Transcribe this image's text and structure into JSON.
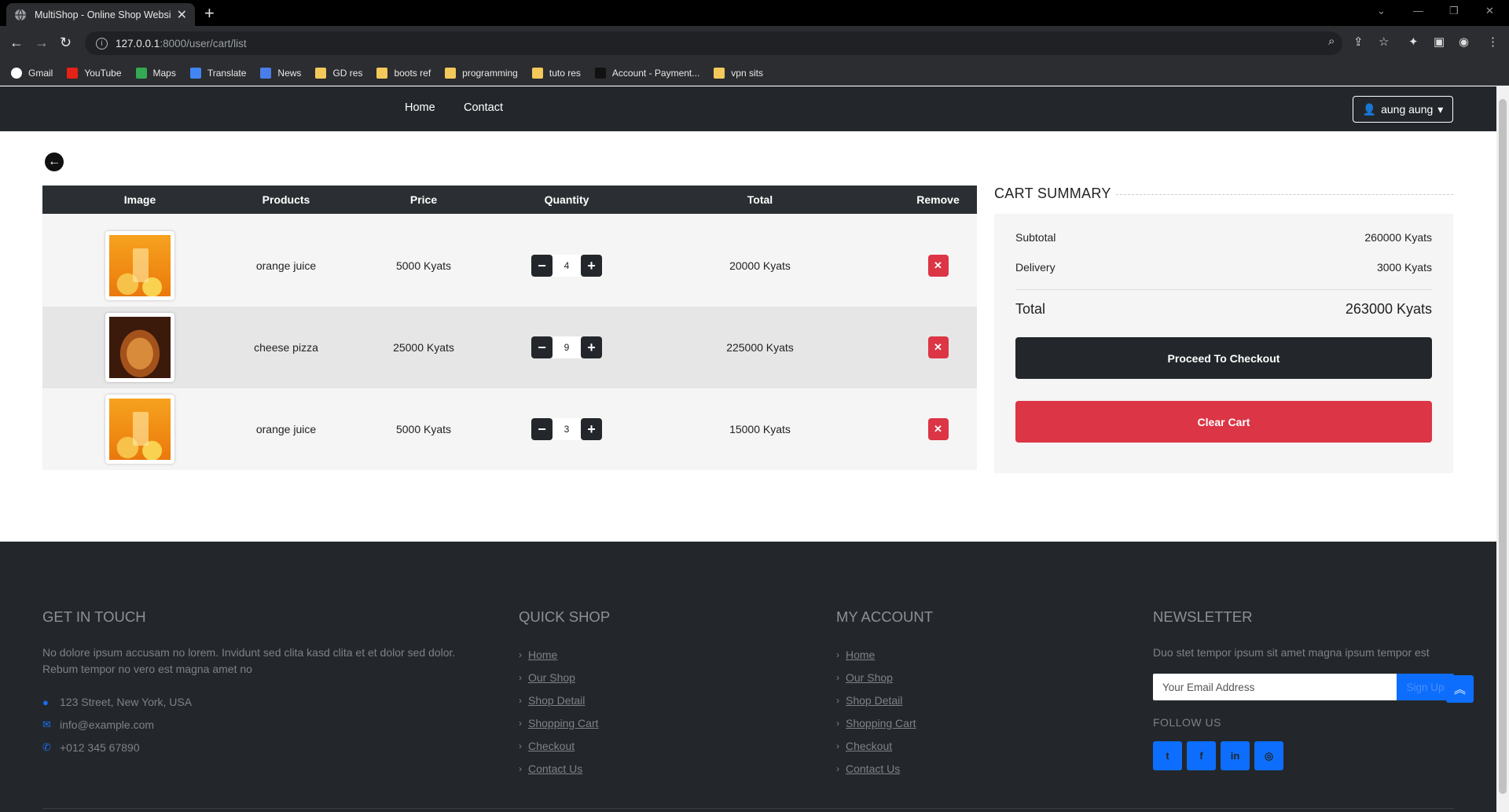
{
  "browser": {
    "tab_title": "MultiShop - Online Shop Website",
    "tab_close": "✕",
    "new_tab": "+",
    "url_host": "127.0.0.1",
    "url_path": ":8000/user/cart/list",
    "bookmarks": [
      {
        "label": "Gmail",
        "icon": "gmail-icon"
      },
      {
        "label": "YouTube",
        "icon": "youtube-icon"
      },
      {
        "label": "Maps",
        "icon": "maps-icon"
      },
      {
        "label": "Translate",
        "icon": "translate-icon"
      },
      {
        "label": "News",
        "icon": "news-icon"
      },
      {
        "label": "GD res",
        "icon": "folder-icon"
      },
      {
        "label": "boots ref",
        "icon": "folder-icon"
      },
      {
        "label": "programming",
        "icon": "folder-icon"
      },
      {
        "label": "tuto res",
        "icon": "folder-icon"
      },
      {
        "label": "Account - Payment...",
        "icon": "account-icon"
      },
      {
        "label": "vpn sits",
        "icon": "folder-icon"
      }
    ]
  },
  "nav": {
    "home": "Home",
    "contact": "Contact",
    "user": "aung aung"
  },
  "cart": {
    "headers": {
      "image": "Image",
      "products": "Products",
      "price": "Price",
      "quantity": "Quantity",
      "total": "Total",
      "remove": "Remove"
    },
    "items": [
      {
        "product": "orange juice",
        "price": "5000 Kyats",
        "qty": "4",
        "total": "20000 Kyats",
        "image": "orange-juice"
      },
      {
        "product": "cheese pizza",
        "price": "25000 Kyats",
        "qty": "9",
        "total": "225000 Kyats",
        "image": "cheese-pizza"
      },
      {
        "product": "orange juice",
        "price": "5000 Kyats",
        "qty": "3",
        "total": "15000 Kyats",
        "image": "orange-juice"
      }
    ]
  },
  "summary": {
    "title": "CART SUMMARY",
    "subtotal_label": "Subtotal",
    "subtotal": "260000 Kyats",
    "delivery_label": "Delivery",
    "delivery": "3000 Kyats",
    "total_label": "Total",
    "total": "263000 Kyats",
    "checkout": "Proceed To Checkout",
    "clear": "Clear Cart",
    "checkout_color": "#23272b",
    "clear_color": "#dc3545"
  },
  "footer": {
    "touch_title": "GET IN TOUCH",
    "touch_text": "No dolore ipsum accusam no lorem. Invidunt sed clita kasd clita et et dolor sed dolor. Rebum tempor no vero est magna amet no",
    "address": "123 Street, New York, USA",
    "email": "info@example.com",
    "phone": "+012 345 67890",
    "quick_title": "QUICK SHOP",
    "account_title": "MY ACCOUNT",
    "links": [
      "Home",
      "Our Shop",
      "Shop Detail",
      "Shopping Cart",
      "Checkout",
      "Contact Us"
    ],
    "news_title": "NEWSLETTER",
    "news_text": "Duo stet tempor ipsum sit amet magna ipsum tempor est",
    "email_placeholder": "Your Email Address",
    "signup": "Sign Up",
    "follow": "FOLLOW US",
    "accent": "#0d6efd"
  }
}
